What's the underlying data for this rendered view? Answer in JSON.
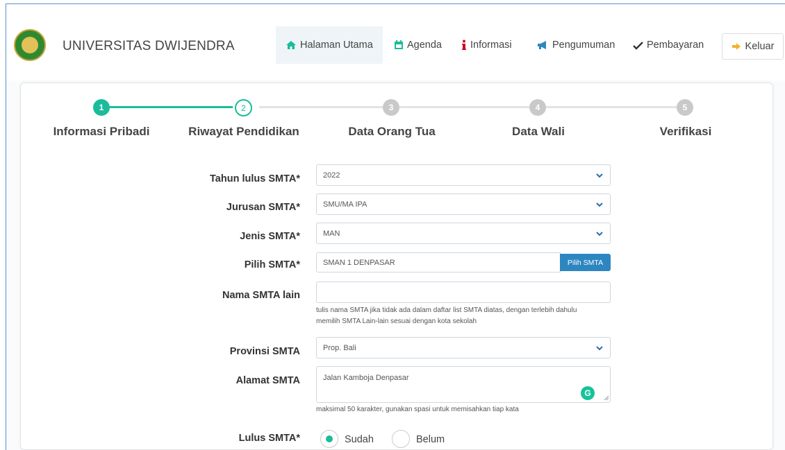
{
  "brand": {
    "name": "UNIVERSITAS DWIJENDRA"
  },
  "nav": {
    "items": [
      {
        "label": "Halaman Utama",
        "icon": "home-icon"
      },
      {
        "label": "Agenda",
        "icon": "calendar-icon"
      },
      {
        "label": "Informasi",
        "icon": "info-icon"
      },
      {
        "label": "Pengumuman",
        "icon": "bullhorn-icon"
      },
      {
        "label": "Pembayaran",
        "icon": "check-icon"
      }
    ],
    "logout_label": "Keluar"
  },
  "stepper": {
    "steps": [
      {
        "number": "1",
        "label": "Informasi Pribadi",
        "state": "done"
      },
      {
        "number": "2",
        "label": "Riwayat Pendidikan",
        "state": "current"
      },
      {
        "number": "3",
        "label": "Data Orang Tua",
        "state": "pending"
      },
      {
        "number": "4",
        "label": "Data Wali",
        "state": "pending"
      },
      {
        "number": "5",
        "label": "Verifikasi",
        "state": "pending"
      }
    ],
    "accent": "#1abc9c"
  },
  "form": {
    "tahun_lulus": {
      "label": "Tahun lulus SMTA*",
      "value": "2022"
    },
    "jurusan": {
      "label": "Jurusan SMTA*",
      "value": "SMU/MA IPA"
    },
    "jenis": {
      "label": "Jenis SMTA*",
      "value": "MAN"
    },
    "pilih": {
      "label": "Pilih SMTA*",
      "value": "SMAN 1 DENPASAR",
      "button": "Pilih SMTA"
    },
    "nama_lain": {
      "label": "Nama SMTA lain",
      "value": "",
      "help_line1": "tulis nama SMTA jika tidak ada dalam daftar list SMTA diatas, dengan terlebih dahulu",
      "help_line2": "memilih SMTA Lain-lain sesuai dengan kota sekolah"
    },
    "provinsi": {
      "label": "Provinsi SMTA",
      "value": "Prop. Bali"
    },
    "alamat": {
      "label": "Alamat SMTA",
      "value": "Jalan Kamboja Denpasar",
      "help": "maksimal 50 karakter, gunakan spasi untuk memisahkan tiap kata"
    },
    "lulus": {
      "label": "Lulus SMTA*",
      "option_yes": "Sudah",
      "option_no": "Belum",
      "selected": "Sudah"
    }
  },
  "colors": {
    "accent": "#1abc9c",
    "button_blue": "#2e86c1",
    "frame_border": "#5b8fd6"
  }
}
